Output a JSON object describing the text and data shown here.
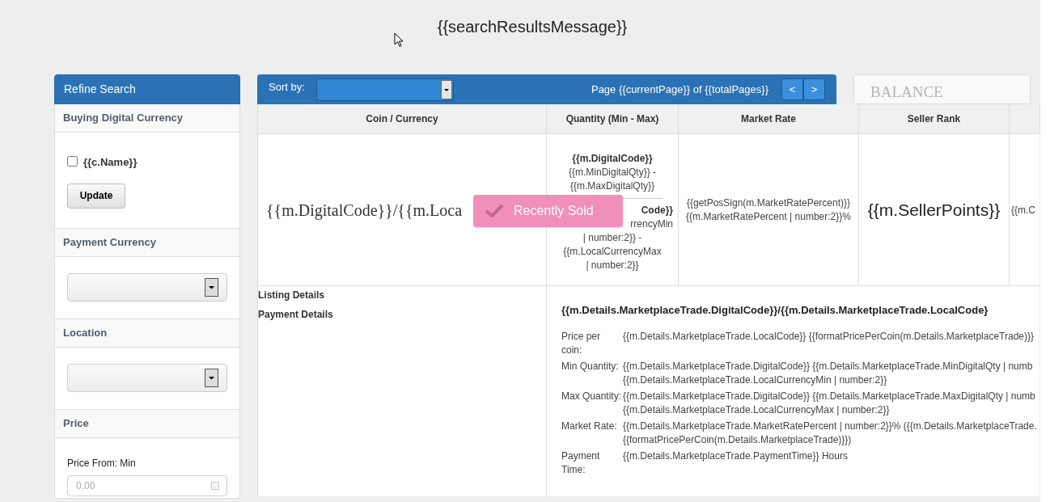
{
  "header": {
    "message": "{{searchResultsMessage}}"
  },
  "sidebar": {
    "title": "Refine Search",
    "sections": [
      {
        "kind": "checkboxes",
        "title": "Buying Digital Currency",
        "options": [
          {
            "label": "{{c.Name}}",
            "checked": false
          }
        ],
        "button": "Update"
      },
      {
        "kind": "select",
        "title": "Payment Currency"
      },
      {
        "kind": "select",
        "title": "Location"
      },
      {
        "kind": "price",
        "title": "Price",
        "label": "Price From: Min",
        "placeholder": "0.00"
      }
    ]
  },
  "toolbar": {
    "sort_label": "Sort by:",
    "pager": "Page {{currentPage}} of {{totalPages}}",
    "prev": "<",
    "next": ">"
  },
  "balance": {
    "label": "BALANCE"
  },
  "table": {
    "columns": [
      "Coin / Currency",
      "Quantity (Min - Max)",
      "Market Rate",
      "Seller Rank"
    ],
    "row": {
      "coin": "{{m.DigitalCode}}/{{m.Loca",
      "quantity_top": [
        "{{m.DigitalCode}}",
        "{{m.MinDigitalQty}} -",
        "{{m.MaxDigitalQty}}"
      ],
      "quantity_bottom": [
        "Code}}",
        "rrencyMin",
        "| number:2}} -",
        "{{m.LocalCurrencyMax",
        "| number:2}}"
      ],
      "market_rate": "{{getPosSign(m.MarketRatePercent)}} {{m.MarketRatePercent | number:2}}%",
      "seller_rank": "{{m.SellerPoints}}",
      "column_5": "{{m.C"
    },
    "details": {
      "links": [
        "Listing Details",
        "Payment Details"
      ],
      "title": "{{m.Details.MarketplaceTrade.DigitalCode}}/{{m.Details.MarketplaceTrade.LocalCode}",
      "fields": [
        {
          "label": "Price per coin:",
          "value": "{{m.Details.MarketplaceTrade.LocalCode}} {{formatPricePerCoin(m.Details.MarketplaceTrade)}}"
        },
        {
          "label": "Min Quantity:",
          "value": "{{m.Details.MarketplaceTrade.DigitalCode}} {{m.Details.MarketplaceTrade.MinDigitalQty | numb {{m.Details.MarketplaceTrade.LocalCurrencyMin | number:2}}"
        },
        {
          "label": "Max Quantity:",
          "value": "{{m.Details.MarketplaceTrade.DigitalCode}} {{m.Details.MarketplaceTrade.MaxDigitalQty | numb {{m.Details.MarketplaceTrade.LocalCurrencyMax | number:2}}"
        },
        {
          "label": "Market Rate:",
          "value": "{{m.Details.MarketplaceTrade.MarketRatePercent | number:2}}% ({{m.Details.MarketplaceTrade. {{formatPricePerCoin(m.Details.MarketplaceTrade)}})"
        },
        {
          "label": "Payment Time:",
          "value": "{{m.Details.MarketplaceTrade.PaymentTime}} Hours"
        }
      ]
    }
  },
  "toast": {
    "text": "Recently Sold"
  }
}
